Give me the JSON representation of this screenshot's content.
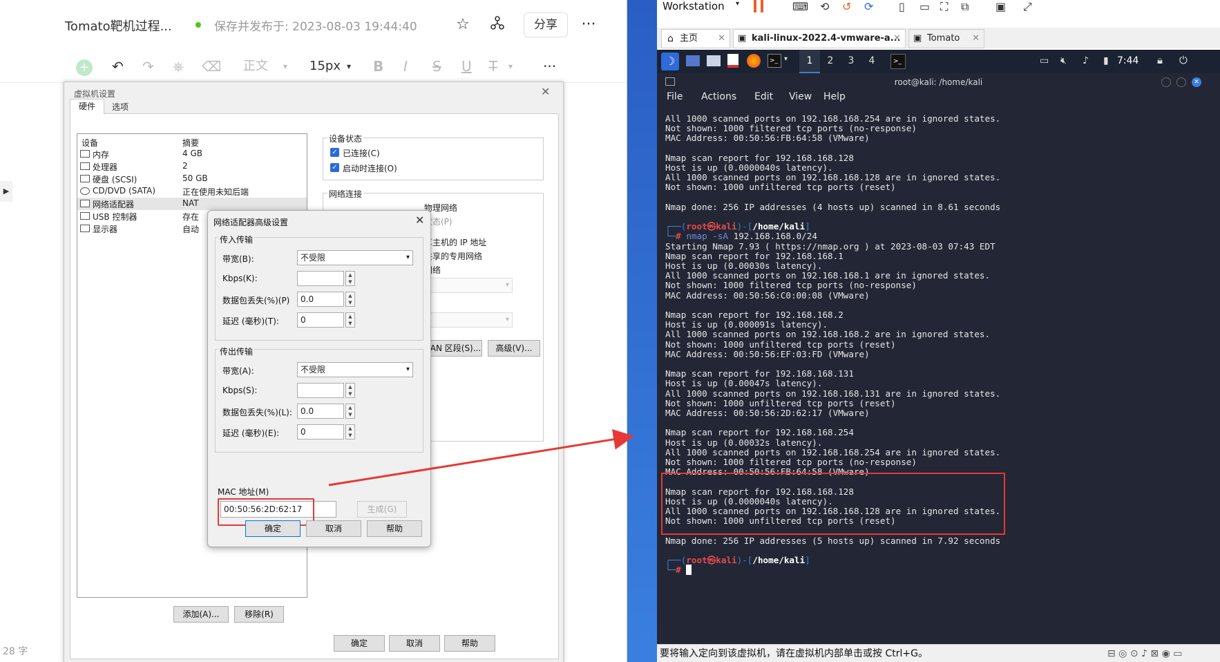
{
  "editor": {
    "title": "Tomato靶机过程...",
    "save_status": "保存并发布于: 2023-08-03 19:44:40",
    "share_label": "分享",
    "toolbar": {
      "heading": "正文",
      "font_size": "15px"
    },
    "word_count": "28 字"
  },
  "vm_settings": {
    "title": "虚拟机设置",
    "tabs": [
      "硬件",
      "选项"
    ],
    "col_device": "设备",
    "col_summary": "摘要",
    "devices": [
      {
        "name": "内存",
        "value": "4 GB"
      },
      {
        "name": "处理器",
        "value": "2"
      },
      {
        "name": "硬盘 (SCSI)",
        "value": "50 GB"
      },
      {
        "name": "CD/DVD (SATA)",
        "value": "正在使用未知后端"
      },
      {
        "name": "网络适配器",
        "value": "NAT"
      },
      {
        "name": "USB 控制器",
        "value": "存在"
      },
      {
        "name": "显示器",
        "value": "自动"
      }
    ],
    "device_state_label": "设备状态",
    "connected_label": "已连接(C)",
    "connect_on_start_label": "启动时连接(O)",
    "net_connection_label": "网络连接",
    "net_bridged_frag": "物理网络",
    "net_state_frag": "状态(P)",
    "net_nat_frag": "享主机的 IP 地址",
    "net_host_frag": "共享的专用网络",
    "net_custom_frag": "网络",
    "lan_btn": "LAN 区段(S)...",
    "advanced_btn": "高级(V)...",
    "add_btn": "添加(A)...",
    "remove_btn": "移除(R)",
    "ok_btn": "确定",
    "cancel_btn": "取消",
    "help_btn": "帮助"
  },
  "adapter": {
    "title": "网络适配器高级设置",
    "incoming_label": "传入传输",
    "outgoing_label": "传出传输",
    "bandwidth_label_in": "带宽(B):",
    "bandwidth_label_out": "带宽(A):",
    "bandwidth_value": "不受限",
    "kbps_label_in": "Kbps(K):",
    "kbps_label_out": "Kbps(S):",
    "loss_label_in": "数据包丢失(%)(P)",
    "loss_label_out": "数据包丢失(%)(L):",
    "loss_value": "0.0",
    "delay_label_in": "延迟 (毫秒)(T):",
    "delay_label_out": "延迟 (毫秒)(E):",
    "delay_value": "0",
    "mac_label": "MAC 地址(M)",
    "mac_value": "00:50:56:2D:62:17",
    "generate_btn": "生成(G)",
    "ok_btn": "确定",
    "cancel_btn": "取消",
    "help_btn": "帮助"
  },
  "vmware": {
    "workstation_label": "Workstation",
    "tabs": [
      "主页",
      "kali-linux-2022.4-vmware-a...",
      "Tomato"
    ],
    "workspaces": [
      "1",
      "2",
      "3",
      "4"
    ],
    "clock": "7:44",
    "status_bar": "要将输入定向到该虚拟机，请在虚拟机内部单击或按 Ctrl+G。"
  },
  "terminal": {
    "title": "root@kali: /home/kali",
    "menu": [
      "File",
      "Actions",
      "Edit",
      "View",
      "Help"
    ],
    "prompt_user": "root",
    "prompt_at": "㉿",
    "prompt_host": "kali",
    "prompt_path": "/home/kali",
    "command": "nmap -sA 192.168.168.0/24",
    "block1": [
      "All 1000 scanned ports on 192.168.168.254 are in ignored states.",
      "Not shown: 1000 filtered tcp ports (no-response)",
      "MAC Address: 00:50:56:FB:64:58 (VMware)",
      "",
      "Nmap scan report for 192.168.168.128",
      "Host is up (0.0000040s latency).",
      "All 1000 scanned ports on 192.168.168.128 are in ignored states.",
      "Not shown: 1000 unfiltered tcp ports (reset)",
      "",
      "Nmap done: 256 IP addresses (4 hosts up) scanned in 8.61 seconds"
    ],
    "block2": [
      "Starting Nmap 7.93 ( https://nmap.org ) at 2023-08-03 07:43 EDT",
      "Nmap scan report for 192.168.168.1",
      "Host is up (0.00030s latency).",
      "All 1000 scanned ports on 192.168.168.1 are in ignored states.",
      "Not shown: 1000 filtered tcp ports (no-response)",
      "MAC Address: 00:50:56:C0:00:08 (VMware)",
      "",
      "Nmap scan report for 192.168.168.2",
      "Host is up (0.000091s latency).",
      "All 1000 scanned ports on 192.168.168.2 are in ignored states.",
      "Not shown: 1000 unfiltered tcp ports (reset)",
      "MAC Address: 00:50:56:EF:03:FD (VMware)",
      "",
      "Nmap scan report for 192.168.168.131",
      "Host is up (0.00047s latency).",
      "All 1000 scanned ports on 192.168.168.131 are in ignored states.",
      "Not shown: 1000 unfiltered tcp ports (reset)",
      "MAC Address: 00:50:56:2D:62:17 (VMware)",
      "",
      "Nmap scan report for 192.168.168.254",
      "Host is up (0.00032s latency).",
      "All 1000 scanned ports on 192.168.168.254 are in ignored states.",
      "Not shown: 1000 filtered tcp ports (no-response)",
      "MAC Address: 00:50:56:FB:64:58 (VMware)",
      "",
      "Nmap scan report for 192.168.168.128",
      "Host is up (0.0000040s latency).",
      "All 1000 scanned ports on 192.168.168.128 are in ignored states.",
      "Not shown: 1000 unfiltered tcp ports (reset)",
      "",
      "Nmap done: 256 IP addresses (5 hosts up) scanned in 7.92 seconds"
    ]
  },
  "colors": {
    "highlight": "#e53935",
    "kali_bg": "#232735",
    "kali_panel": "#1b2332",
    "prompt_red": "#e84a4a",
    "prompt_blue": "#3e7cd8"
  }
}
